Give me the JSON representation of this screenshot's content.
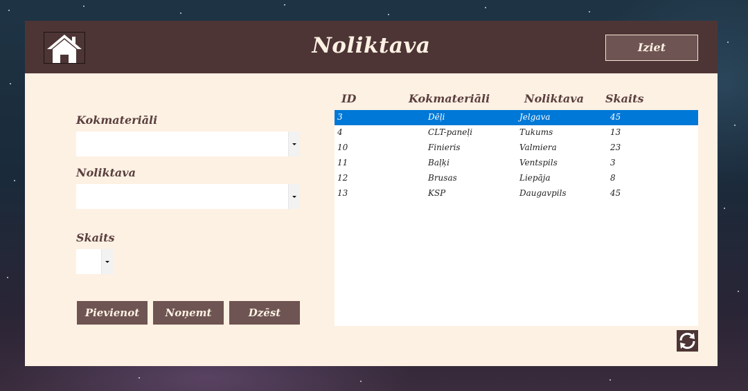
{
  "header": {
    "title": "Noliktava",
    "exit_label": "Iziet"
  },
  "form": {
    "material_label": "Kokmateriāli",
    "material_value": "",
    "warehouse_label": "Noliktava",
    "warehouse_value": "",
    "quantity_label": "Skaits",
    "quantity_value": ""
  },
  "buttons": {
    "add": "Pievienot",
    "remove": "Noņemt",
    "delete": "Dzēst"
  },
  "table": {
    "columns": [
      "ID",
      "Kokmateriāli",
      "Noliktava",
      "Skaits"
    ],
    "rows": [
      [
        "3",
        "Dēļi",
        "Jelgava",
        "45"
      ],
      [
        "4",
        "CLT-paneļi",
        "Tukums",
        "13"
      ],
      [
        "10",
        "Finieris",
        "Valmiera",
        "23"
      ],
      [
        "11",
        "Baļķi",
        "Ventspils",
        "3"
      ],
      [
        "12",
        "Brusas",
        "Liepāja",
        "8"
      ],
      [
        "13",
        "KSP",
        "Daugavpils",
        "45"
      ]
    ],
    "selected_row": 0
  },
  "colors": {
    "header": "#4d3535",
    "panel": "#fdf1e3",
    "button": "#6e5452",
    "selection": "#0078d7"
  },
  "icons": {
    "home": "home-icon",
    "refresh": "refresh-icon",
    "dropdown": "chevron-down-icon"
  }
}
